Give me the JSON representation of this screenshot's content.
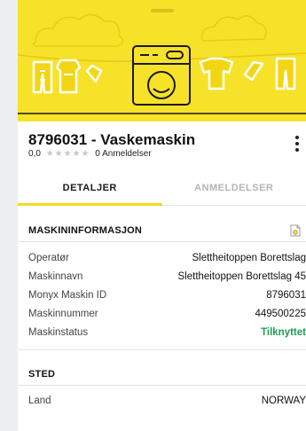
{
  "machine": {
    "title": "8796031 - Vaskemaskin",
    "rating_value": "0,0",
    "stars": "★★★★★",
    "reviews_label": "0 Anmeldelser"
  },
  "tabs": [
    {
      "label": "DETALJER",
      "active": true
    },
    {
      "label": "ANMELDELSER",
      "active": false
    }
  ],
  "machine_info": {
    "heading": "MASKININFORMASJON",
    "rows": [
      {
        "label": "Operatør",
        "value": "Slettheitoppen Borettslag"
      },
      {
        "label": "Maskinnavn",
        "value": "Slettheitoppen Borettslag 45"
      },
      {
        "label": "Monyx Maskin ID",
        "value": "8796031"
      },
      {
        "label": "Maskinnummer",
        "value": "449500225"
      },
      {
        "label": "Maskinstatus",
        "value": "Tilknyttet"
      }
    ]
  },
  "location": {
    "heading": "STED",
    "rows": [
      {
        "label": "Land",
        "value": "NORWAY"
      }
    ]
  },
  "colors": {
    "banner": "#f7e22a",
    "tab_indicator": "#f5d91f",
    "status_green": "#1e9e55"
  },
  "icons": [
    "washing-machine-illustration",
    "more-vert-icon",
    "document-icon"
  ]
}
